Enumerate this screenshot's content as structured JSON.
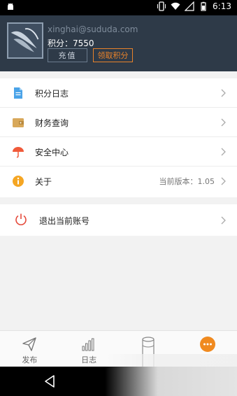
{
  "status_bar": {
    "time": "6:13",
    "icons": [
      "android-debug-icon",
      "vibrate-icon",
      "wifi-icon",
      "signal-icon",
      "battery-icon"
    ]
  },
  "profile": {
    "email": "xinghai@sududa.com",
    "points_label": "积分：7550",
    "recharge_label": "充值",
    "claim_label": "领取积分"
  },
  "menu": {
    "items": [
      {
        "label": "积分日志",
        "icon": "document-icon",
        "value": ""
      },
      {
        "label": "财务查询",
        "icon": "wallet-icon",
        "value": ""
      },
      {
        "label": "安全中心",
        "icon": "umbrella-icon",
        "value": ""
      },
      {
        "label": "关于",
        "icon": "info-icon",
        "value": "当前版本：1.05"
      }
    ],
    "logout_label": "退出当前账号"
  },
  "tabbar": {
    "tabs": [
      {
        "label": "发布",
        "icon": "send-icon"
      },
      {
        "label": "日志",
        "icon": "bar-chart-icon"
      },
      {
        "label": "",
        "icon": "cylinder-icon"
      },
      {
        "label": "",
        "icon": "more-icon"
      }
    ]
  },
  "colors": {
    "header_bg": "#2e3a48",
    "accent": "#f08a1f",
    "logout_red": "#e5493a"
  }
}
